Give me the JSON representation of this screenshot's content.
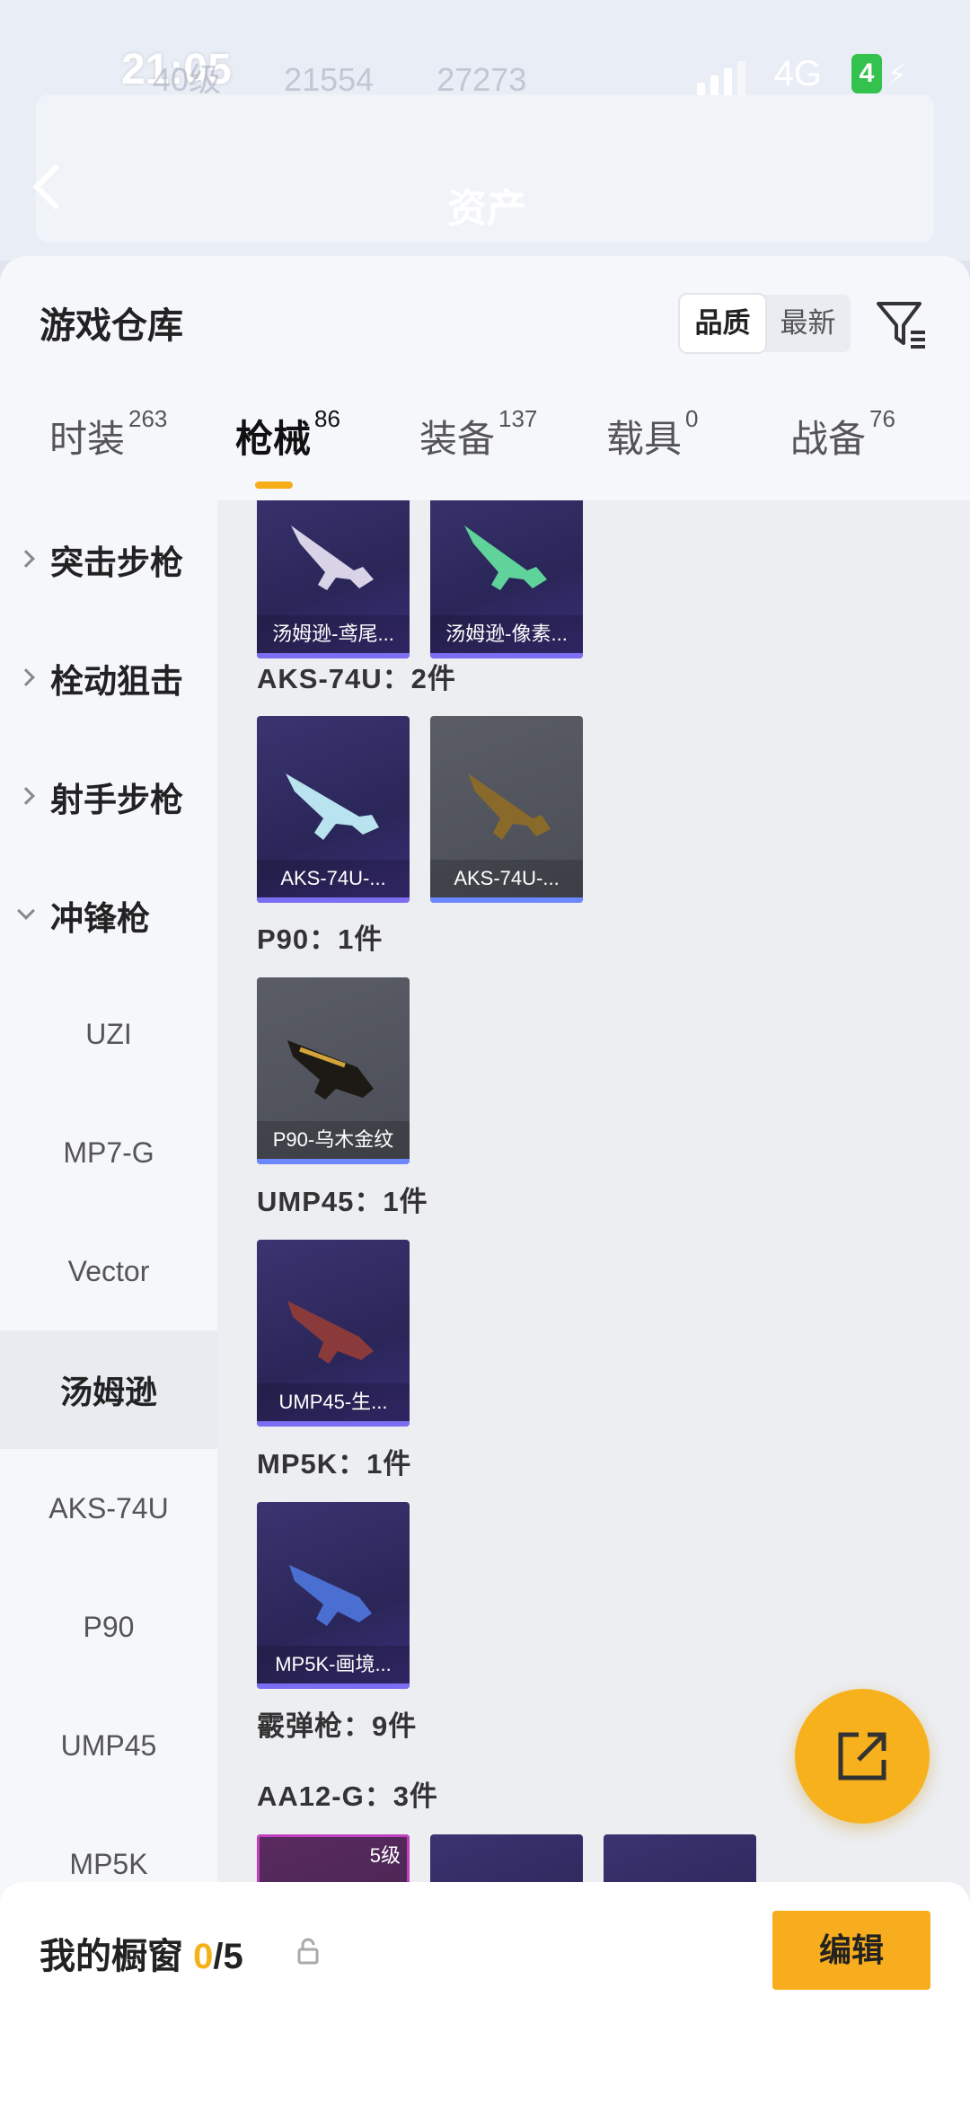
{
  "status": {
    "time": "21:05",
    "network": "4G",
    "battery": "4"
  },
  "background": {
    "stats": [
      "40级",
      "21554",
      "27273"
    ],
    "title": "资产"
  },
  "sheet": {
    "title": "游戏仓库",
    "sort": [
      "品质",
      "最新"
    ],
    "active_sort": "品质"
  },
  "tabs": [
    {
      "label": "时装",
      "count": "263"
    },
    {
      "label": "枪械",
      "count": "86"
    },
    {
      "label": "装备",
      "count": "137"
    },
    {
      "label": "载具",
      "count": "0"
    },
    {
      "label": "战备",
      "count": "76"
    }
  ],
  "sidebar": {
    "categories": [
      "突击步枪",
      "栓动狙击",
      "射手步枪",
      "冲锋枪"
    ],
    "subitems": [
      "UZI",
      "MP7-G",
      "Vector",
      "汤姆逊",
      "AKS-74U",
      "P90",
      "UMP45",
      "MP5K"
    ],
    "selected": "汤姆逊"
  },
  "content": {
    "groups": [
      {
        "label": "",
        "items": [
          "汤姆逊-鸢尾...",
          "汤姆逊-像素..."
        ]
      },
      {
        "label": "AKS-74U：2件",
        "items": [
          "AKS-74U-...",
          "AKS-74U-..."
        ]
      },
      {
        "label": "P90：1件",
        "items": [
          "P90-乌木金纹"
        ]
      },
      {
        "label": "UMP45：1件",
        "items": [
          "UMP45-生..."
        ]
      },
      {
        "label": "MP5K：1件",
        "items": [
          "MP5K-画境..."
        ]
      },
      {
        "label": "霰弹枪：9件",
        "items": []
      },
      {
        "label": "AA12-G：3件",
        "items": [
          "",
          "",
          ""
        ]
      }
    ],
    "level_badge": "5级"
  },
  "colors": {
    "accent": "#f6ad18",
    "purple_card": "#2a2658",
    "gray_card": "#4a4d55"
  },
  "bottom": {
    "title": "我的橱窗",
    "count_current": "0",
    "count_total": "/5",
    "edit_label": "编辑"
  }
}
